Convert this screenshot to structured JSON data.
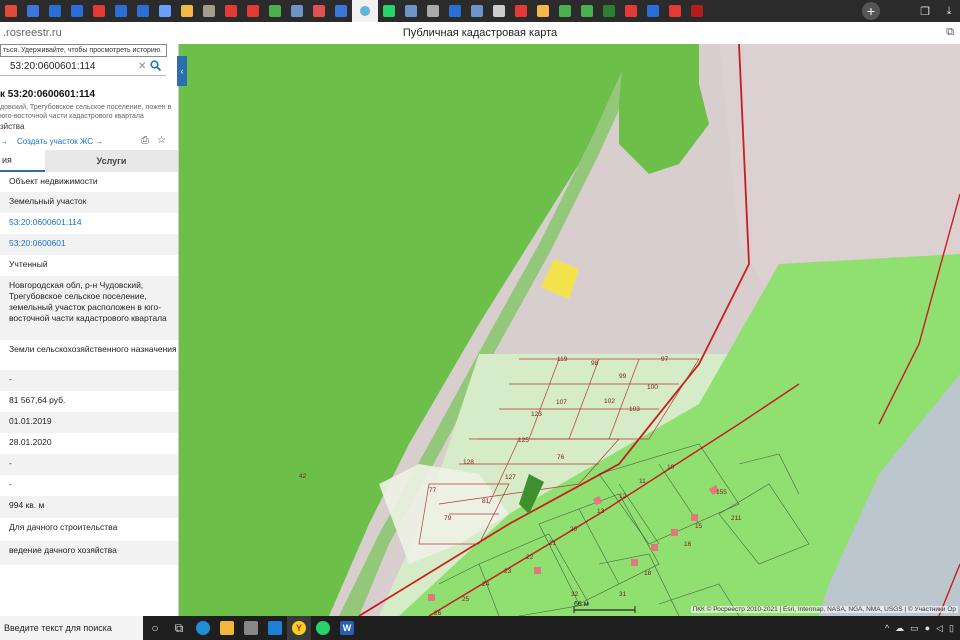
{
  "browser": {
    "url": ".rosreestr.ru",
    "page_title": "Публичная кадастровая карта",
    "tabs": [
      {
        "icon": "tab-icon",
        "color": "#e04a3a"
      },
      {
        "icon": "tab-icon",
        "color": "#3b77d8"
      },
      {
        "icon": "tab-icon",
        "color": "#2a6fd6"
      },
      {
        "icon": "tab-icon",
        "color": "#2a6fd6"
      },
      {
        "icon": "tab-icon",
        "color": "#e53935"
      },
      {
        "icon": "tab-icon",
        "color": "#2a6fd6"
      },
      {
        "icon": "tab-icon",
        "color": "#2a6fd6"
      },
      {
        "icon": "tab-icon",
        "color": "#6aa0ff"
      },
      {
        "icon": "tab-icon",
        "color": "#f2b84b"
      },
      {
        "icon": "tab-icon",
        "color": "#a0a08a"
      },
      {
        "icon": "tab-icon",
        "color": "#e53935"
      },
      {
        "icon": "tab-icon",
        "color": "#e53935"
      },
      {
        "icon": "tab-icon",
        "color": "#4caf50"
      },
      {
        "icon": "tab-icon",
        "color": "#6d93c7"
      },
      {
        "icon": "tab-icon",
        "color": "#e05252"
      },
      {
        "icon": "tab-icon",
        "color": "#3b77d8"
      }
    ],
    "tabs2": [
      {
        "icon": "tab-icon",
        "color": "#25d366"
      },
      {
        "icon": "tab-icon",
        "color": "#6d93c7"
      },
      {
        "icon": "tab-icon",
        "color": "#aaaaaa"
      },
      {
        "icon": "tab-icon",
        "color": "#2a6fd6"
      },
      {
        "icon": "tab-icon",
        "color": "#6d93c7"
      },
      {
        "icon": "tab-icon",
        "color": "#cccccc"
      },
      {
        "icon": "tab-icon",
        "color": "#e53935"
      },
      {
        "icon": "tab-icon",
        "color": "#f2b84b"
      },
      {
        "icon": "tab-icon",
        "color": "#4caf50"
      },
      {
        "icon": "tab-icon",
        "color": "#4caf50"
      },
      {
        "icon": "tab-icon",
        "color": "#2e7d32"
      },
      {
        "icon": "tab-icon",
        "color": "#e53935"
      },
      {
        "icon": "tab-icon",
        "color": "#2a6fd6"
      },
      {
        "icon": "tab-icon",
        "color": "#e53935"
      },
      {
        "icon": "tab-icon",
        "color": "#b71c1c"
      }
    ]
  },
  "sidebar": {
    "tooltip": "ться. Удерживайте, чтобы просмотреть историю.",
    "search_value": "53:20:0600601:114",
    "title": "к 53:20:0600601:114",
    "description": "довский, Трегубовское сельское поселение, ложен в юго-восточной части кадастрового квартала",
    "type_text": "зйства",
    "link_left": "→",
    "link_create": "Создать участок ЖС →",
    "tab_info": "ия",
    "tab_services": "Услуги",
    "rows": [
      {
        "text": "Объект недвижимости",
        "link": false
      },
      {
        "text": "Земельный участок",
        "link": false
      },
      {
        "text": "53:20:0600601:114",
        "link": true
      },
      {
        "text": "53:20:0600601",
        "link": true
      },
      {
        "text": "Учтенный",
        "link": false
      },
      {
        "text": "Новгородская обл, р-н Чудовский, Трегубовское сельское поселение, земельный участок расположен в юго-восточной части кадастрового квартала",
        "link": false
      },
      {
        "text": "Земли сельскохозяйственного назначения",
        "link": false
      },
      {
        "text": "-",
        "link": false
      },
      {
        "text": "81 567,64 руб.",
        "link": false
      },
      {
        "text": "01.01.2019",
        "link": false
      },
      {
        "text": "28.01.2020",
        "link": false
      },
      {
        "text": "-",
        "link": false
      },
      {
        "text": "-",
        "link": false
      },
      {
        "text": "994 кв. м",
        "link": false
      },
      {
        "text": "Для дачного строительства",
        "link": false
      },
      {
        "text": "ведение дачного хозяйства",
        "link": false
      }
    ]
  },
  "map": {
    "parcel_numbers": [
      "119",
      "98",
      "97",
      "99",
      "100",
      "102",
      "103",
      "107",
      "123",
      "125",
      "76",
      "128",
      "127",
      "77",
      "81",
      "79",
      "10",
      "11",
      "12",
      "13",
      "15",
      "16",
      "211",
      "18",
      "20",
      "21",
      "22",
      "23",
      "24",
      "25",
      "26",
      "31",
      "32",
      "42",
      "155"
    ],
    "scale_label": "66 м",
    "attribution": "ПКК © Росреестр 2010-2021 | Esri, Intermap, NASA, NGA, NMA, USGS | © Участники Op"
  },
  "taskbar": {
    "search_placeholder": "Введите текст для поиска"
  }
}
